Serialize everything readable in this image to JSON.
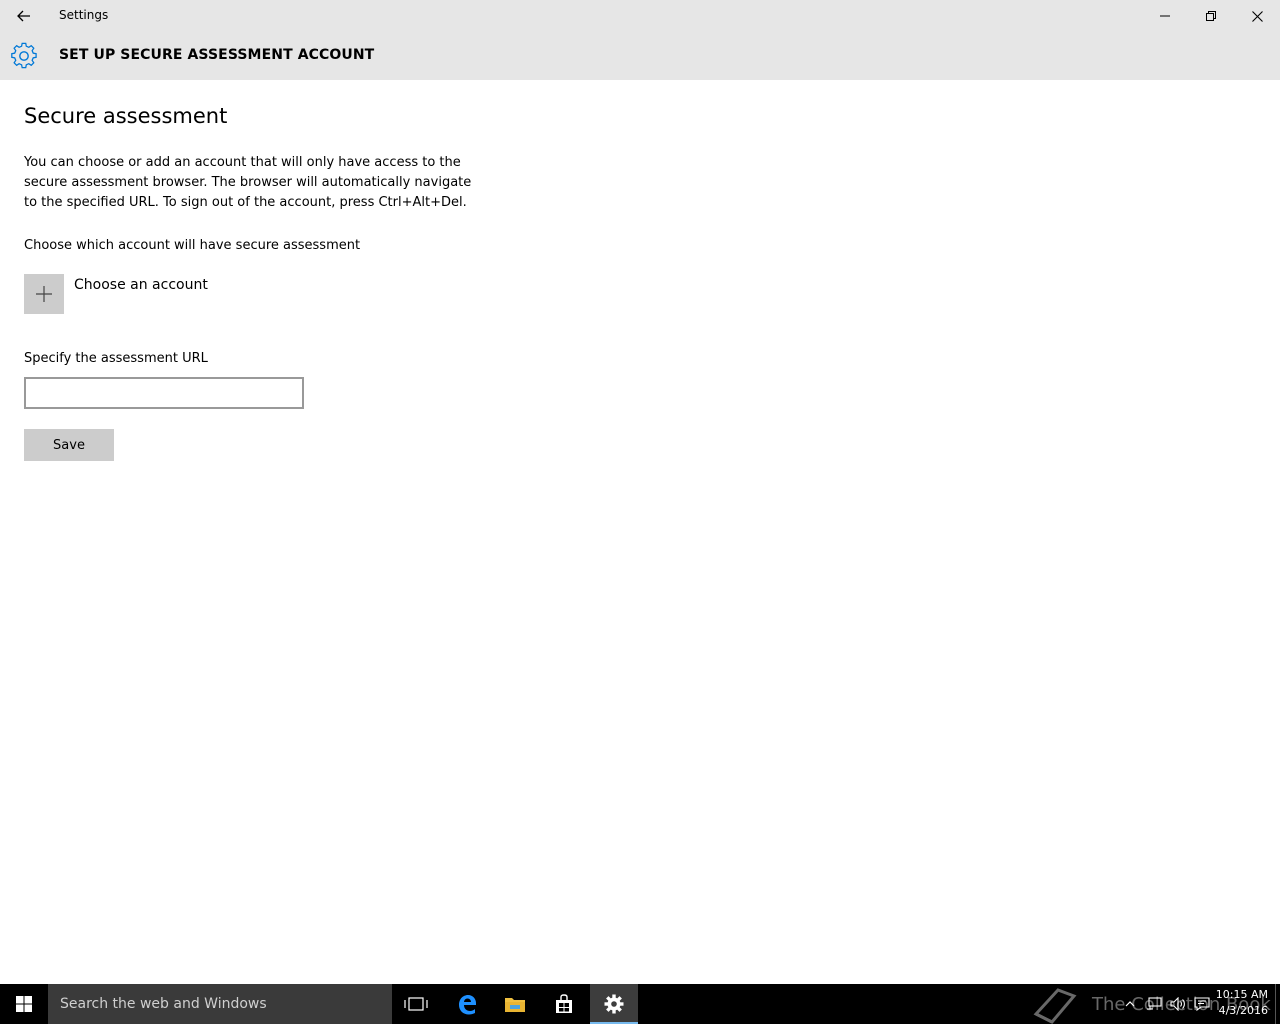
{
  "window": {
    "app_title": "Settings"
  },
  "header": {
    "title": "SET UP SECURE ASSESSMENT ACCOUNT"
  },
  "main": {
    "page_title": "Secure assessment",
    "description": "You can choose or add an account that will only have access to the secure assessment browser. The browser will automatically navigate to the specified URL. To sign out of the account, press Ctrl+Alt+Del.",
    "choose_label": "Choose which account will have secure assessment",
    "choose_account_label": "Choose an account",
    "url_label": "Specify the assessment URL",
    "url_value": "",
    "url_placeholder": "",
    "save_label": "Save"
  },
  "taskbar": {
    "search_placeholder": "Search the web and Windows",
    "watermark": "The Collection Book",
    "clock_time": "10:15 AM",
    "clock_date": "4/3/2016"
  },
  "colors": {
    "chrome_bg": "#e6e6e6",
    "accent": "#0078d7",
    "button_bg": "#cccccc",
    "taskbar_bg": "#000000"
  },
  "icons": {
    "back": "back-arrow-icon",
    "header": "gear-icon",
    "add": "plus-icon",
    "start": "windows-logo-icon",
    "taskview": "task-view-icon",
    "edge": "edge-icon",
    "explorer": "folder-icon",
    "store": "store-icon",
    "settings": "gear-icon"
  }
}
